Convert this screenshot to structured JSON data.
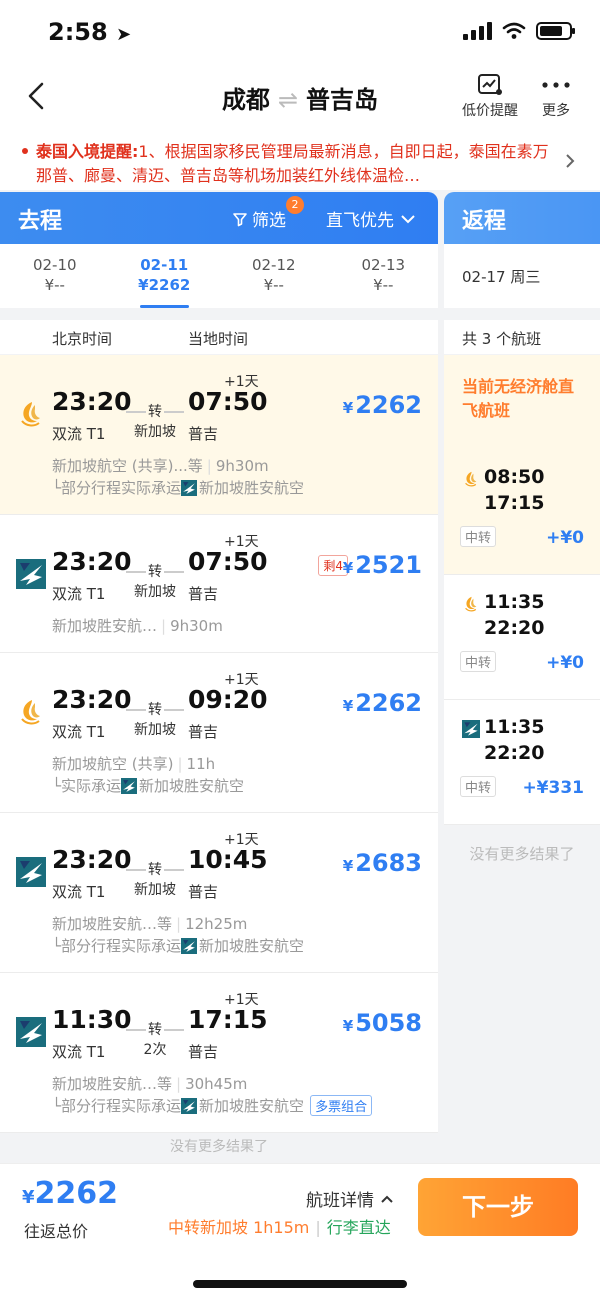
{
  "status": {
    "time": "2:58"
  },
  "nav": {
    "from": "成都",
    "to": "普吉岛",
    "low_price_label": "低价提醒",
    "more_label": "更多"
  },
  "notice": {
    "title": "泰国入境提醒:",
    "text": "1、根据国家移民管理局最新消息，自即日起，泰国在素万那普、廊曼、清迈、普吉岛等机场加装红外线体温检…"
  },
  "outbound": {
    "label": "去程",
    "filter_label": "筛选",
    "filter_count": "2",
    "sort_label": "直飞优先",
    "dates": [
      {
        "date": "02-10",
        "price": "¥--"
      },
      {
        "date": "02-11",
        "price": "¥2262",
        "active": true
      },
      {
        "date": "02-12",
        "price": "¥--"
      },
      {
        "date": "02-13",
        "price": "¥--"
      }
    ],
    "col_beijing": "北京时间",
    "col_local": "当地时间",
    "flights": [
      {
        "dep": "23:20",
        "dep_apt": "双流 T1",
        "via": "转",
        "via2": "新加坡",
        "arr": "07:50",
        "arr_apt": "普吉",
        "plus": "+1天",
        "price": "2262",
        "remain": "",
        "info_airline": "新加坡航空 (共享)...等",
        "info_dur": "9h30m",
        "info2": "部分行程实际承运",
        "info2_airline": "新加坡胜安航空",
        "combo": "",
        "logo": "sq",
        "hl": true
      },
      {
        "dep": "23:20",
        "dep_apt": "双流 T1",
        "via": "转",
        "via2": "新加坡",
        "arr": "07:50",
        "arr_apt": "普吉",
        "plus": "+1天",
        "price": "2521",
        "remain": "剩4",
        "info_airline": "新加坡胜安航…",
        "info_dur": "9h30m",
        "info2": "",
        "info2_airline": "",
        "combo": "",
        "logo": "mi",
        "hl": false
      },
      {
        "dep": "23:20",
        "dep_apt": "双流 T1",
        "via": "转",
        "via2": "新加坡",
        "arr": "09:20",
        "arr_apt": "普吉",
        "plus": "+1天",
        "price": "2262",
        "remain": "",
        "info_airline": "新加坡航空 (共享)",
        "info_dur": "11h",
        "info2": "实际承运",
        "info2_airline": "新加坡胜安航空",
        "combo": "",
        "logo": "sq",
        "hl": false
      },
      {
        "dep": "23:20",
        "dep_apt": "双流 T1",
        "via": "转",
        "via2": "新加坡",
        "arr": "10:45",
        "arr_apt": "普吉",
        "plus": "+1天",
        "price": "2683",
        "remain": "",
        "info_airline": "新加坡胜安航…等",
        "info_dur": "12h25m",
        "info2": "部分行程实际承运",
        "info2_airline": "新加坡胜安航空",
        "combo": "",
        "logo": "mi",
        "hl": false
      },
      {
        "dep": "11:30",
        "dep_apt": "双流 T1",
        "via": "转",
        "via2": "2次",
        "arr": "17:15",
        "arr_apt": "普吉",
        "plus": "+1天",
        "price": "5058",
        "remain": "",
        "info_airline": "新加坡胜安航…等",
        "info_dur": "30h45m",
        "info2": "部分行程实际承运",
        "info2_airline": "新加坡胜安航空",
        "combo": "多票组合",
        "logo": "mi",
        "hl": false
      }
    ],
    "no_more": "没有更多结果了"
  },
  "return": {
    "label": "返程",
    "date": "02-17 周三",
    "count": "共 3 个航班",
    "empty_note": "当前无经济舱直飞航班",
    "flights": [
      {
        "t1": "08:50",
        "t2": "17:15",
        "tag": "中转",
        "diff": "+¥0",
        "logo": "sq",
        "hl": true
      },
      {
        "t1": "11:35",
        "t2": "22:20",
        "tag": "中转",
        "diff": "+¥0",
        "logo": "sq",
        "hl": false
      },
      {
        "t1": "11:35",
        "t2": "22:20",
        "tag": "中转",
        "diff": "+¥331",
        "logo": "mi",
        "hl": false
      }
    ],
    "no_more": "没有更多结果了"
  },
  "bottom": {
    "currency": "¥",
    "total": "2262",
    "total_label": "往返总价",
    "details_label": "航班详情",
    "transfer_note": "中转新加坡 1h15m",
    "luggage_note": "行李直达",
    "next_label": "下一步"
  },
  "colors": {
    "accent": "#2f7ef2",
    "orange": "#ff7d2e",
    "alert": "#e0311d",
    "green": "#25a55b"
  }
}
